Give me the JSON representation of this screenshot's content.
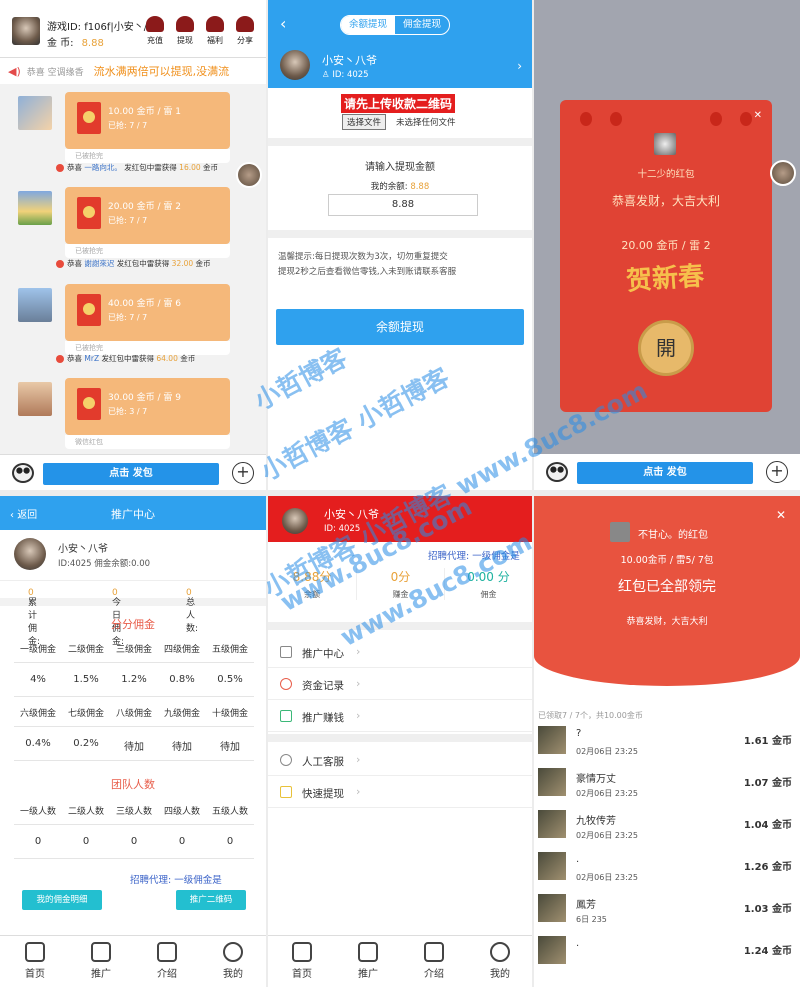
{
  "p1": {
    "game_id": "游戏ID: f106f|小安丶/",
    "gold_label": "金  币:",
    "gold_value": "8.88",
    "top_buttons": [
      "充值",
      "提现",
      "福利",
      "分享"
    ],
    "notice_prefix": "恭喜 空调缘香",
    "notice": "流水满两倍可以提现,没满流",
    "messages": [
      {
        "amount": "10.00 金币 / 雷 1",
        "grabbed": "已抢: 7 / 7",
        "footer": "已被抢完",
        "winner": "一路向北。",
        "prize": "16.00"
      },
      {
        "amount": "20.00 金币 / 雷 2",
        "grabbed": "已抢: 7 / 7",
        "footer": "已被抢完",
        "winner": "謝謝來迟",
        "prize": "32.00"
      },
      {
        "amount": "40.00 金币 / 雷 6",
        "grabbed": "已抢: 7 / 7",
        "footer": "已被抢完",
        "winner": "MrZ",
        "prize": "64.00"
      },
      {
        "amount": "30.00 金币 / 雷 9",
        "grabbed": "已抢: 3 / 7",
        "footer": "微信红包",
        "winner": "",
        "prize": ""
      }
    ],
    "win_prefix": "恭喜",
    "win_mid": "发红包中雷获得",
    "win_suffix": "金币",
    "send": "点击 发包"
  },
  "p2": {
    "tabs": [
      "余额提现",
      "佣金提现"
    ],
    "name": "小安丶八爷",
    "id": "ID: 4025",
    "upload": "请先上传收款二维码",
    "file_btn": "选择文件",
    "file_txt": "未选择任何文件",
    "label": "请输入提现金额",
    "balance_label": "我的余额:",
    "balance_value": "8.88",
    "input_value": "8.88",
    "tip1": "温馨提示:每日提现次数为3次，切勿重复提交",
    "tip2": "提现2秒之后查看微信零钱,入未到账请联系客服",
    "button": "余额提现"
  },
  "p3": {
    "from": "十二少的红包",
    "wish": "恭喜发财，大吉大利",
    "amount": "20.00 金币 / 雷 2",
    "art": "贺新春",
    "open": "開",
    "send": "点击 发包"
  },
  "p4": {
    "back": "返回",
    "title": "推广中心",
    "name": "小安丶八爷",
    "sub": "ID:4025 佣金余额:0.00",
    "stats": [
      {
        "l": "累计佣金:",
        "v": "0"
      },
      {
        "l": "今日佣金:",
        "v": "0"
      },
      {
        "l": "总人数:",
        "v": "0"
      }
    ],
    "section1": "分分佣金",
    "h1": [
      "一级佣金",
      "二级佣金",
      "三级佣金",
      "四级佣金",
      "五级佣金"
    ],
    "v1": [
      "4%",
      "1.5%",
      "1.2%",
      "0.8%",
      "0.5%"
    ],
    "h2": [
      "六级佣金",
      "七级佣金",
      "八级佣金",
      "九级佣金",
      "十级佣金"
    ],
    "v2": [
      "0.4%",
      "0.2%",
      "待加",
      "待加",
      "待加"
    ],
    "section2": "团队人数",
    "h3": [
      "一级人数",
      "二级人数",
      "三级人数",
      "四级人数",
      "五级人数"
    ],
    "v3": [
      "0",
      "0",
      "0",
      "0",
      "0"
    ],
    "recruit": "招聘代理:  一级佣金是",
    "btn1": "我的佣金明细",
    "btn2": "推广二维码",
    "tabs": [
      "首页",
      "推广",
      "介绍",
      "我的"
    ]
  },
  "p5": {
    "name": "小安丶八爷",
    "id": "ID: 4025",
    "recruit": "招聘代理:  一级佣金是",
    "money": [
      {
        "v": "8.88分",
        "l": "余额"
      },
      {
        "v": "0分",
        "l": "赚金"
      },
      {
        "v": "0.00 分",
        "l": "佣金"
      }
    ],
    "menu": [
      "推广中心",
      "资金记录",
      "推广赚钱",
      "人工客服",
      "快速提现"
    ],
    "tabs": [
      "首页",
      "推广",
      "介绍",
      "我的"
    ]
  },
  "p6": {
    "from": "不甘心。的红包",
    "amount": "10.00金币 / 雷5/ 7包",
    "done": "红包已全部领完",
    "wish": "恭喜发财，大吉大利",
    "summary": "已领取7 / 7个，共10.00金币",
    "rows": [
      {
        "n": "?",
        "t": "02月06日  23:25",
        "m": "1.61 金币"
      },
      {
        "n": "豪情万丈",
        "t": "02月06日  23:25",
        "m": "1.07 金币"
      },
      {
        "n": "九牧传芳",
        "t": "02月06日  23:25",
        "m": "1.04 金币"
      },
      {
        "n": ".",
        "t": "02月06日  23:25",
        "m": "1.26 金币"
      },
      {
        "n": "鳳芳",
        "t": "6日  235",
        "m": "1.03 金币"
      },
      {
        "n": ".",
        "t": "",
        "m": "1.24 金币"
      }
    ]
  },
  "watermark": [
    "小哲博客",
    "小哲博客 小哲博客",
    "小哲博客 小哲博客 www.8uc8.com",
    "www.8uc8.com",
    "www.8uc8.com"
  ]
}
